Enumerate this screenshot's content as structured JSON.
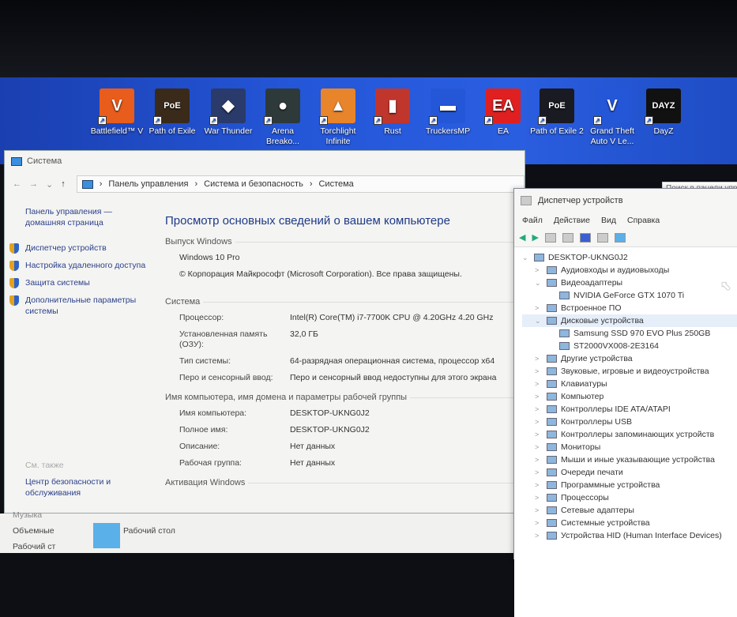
{
  "desktop_icons": [
    {
      "label": "Battlefield™ V",
      "color": "#e85c1c",
      "glyph": "V"
    },
    {
      "label": "Path of Exile",
      "color": "#3a2a1a",
      "glyph": "PoE"
    },
    {
      "label": "War Thunder",
      "color": "#2a3a6a",
      "glyph": "◆"
    },
    {
      "label": "Arena Breako...",
      "color": "#2e3a3a",
      "glyph": "●"
    },
    {
      "label": "Torchlight Infinite",
      "color": "#e8842a",
      "glyph": "▲"
    },
    {
      "label": "Rust",
      "color": "#c0362c",
      "glyph": "▮"
    },
    {
      "label": "TruckersMP",
      "color": "#2456d8",
      "glyph": "▬"
    },
    {
      "label": "EA",
      "color": "#e02020",
      "glyph": "EA"
    },
    {
      "label": "Path of Exile 2",
      "color": "#1a1a22",
      "glyph": "PoE"
    },
    {
      "label": "Grand Theft Auto V Le...",
      "color": "#2456d8",
      "glyph": "V"
    },
    {
      "label": "DayZ",
      "color": "#111",
      "glyph": "DAYZ"
    }
  ],
  "system_window": {
    "title": "Система",
    "breadcrumb": [
      "Панель управления",
      "Система и безопасность",
      "Система"
    ],
    "search_placeholder": "Поиск в панели управления",
    "left_links": {
      "home": "Панель управления — домашняя страница",
      "items": [
        "Диспетчер устройств",
        "Настройка удаленного доступа",
        "Защита системы",
        "Дополнительные параметры системы"
      ],
      "see_also": "См. также",
      "security": "Центр безопасности и обслуживания"
    },
    "heading": "Просмотр основных сведений о вашем компьютере",
    "edition_section": "Выпуск Windows",
    "edition": "Windows 10 Pro",
    "copyright": "© Корпорация Майкрософт (Microsoft Corporation). Все права защищены.",
    "system_section": "Система",
    "system_rows": [
      {
        "k": "Процессор:",
        "v": "Intel(R) Core(TM) i7-7700K CPU @ 4.20GHz   4.20 GHz"
      },
      {
        "k": "Установленная память (ОЗУ):",
        "v": "32,0 ГБ"
      },
      {
        "k": "Тип системы:",
        "v": "64-разрядная операционная система, процессор x64"
      },
      {
        "k": "Перо и сенсорный ввод:",
        "v": "Перо и сенсорный ввод недоступны для этого экрана"
      }
    ],
    "name_section": "Имя компьютера, имя домена и параметры рабочей группы",
    "name_rows": [
      {
        "k": "Имя компьютера:",
        "v": "DESKTOP-UKNG0J2"
      },
      {
        "k": "Полное имя:",
        "v": "DESKTOP-UKNG0J2"
      },
      {
        "k": "Описание:",
        "v": "Нет данных"
      },
      {
        "k": "Рабочая группа:",
        "v": "Нет данных"
      }
    ],
    "activation_section": "Активация Windows"
  },
  "device_manager": {
    "title": "Диспетчер устройств",
    "menu": [
      "Файл",
      "Действие",
      "Вид",
      "Справка"
    ],
    "tree": [
      {
        "label": "DESKTOP-UKNG0J2",
        "level": 0,
        "exp": "v"
      },
      {
        "label": "Аудиовходы и аудиовыходы",
        "level": 1,
        "exp": ">"
      },
      {
        "label": "Видеоадаптеры",
        "level": 1,
        "exp": "v"
      },
      {
        "label": "NVIDIA GeForce GTX 1070 Ti",
        "level": 2,
        "exp": ""
      },
      {
        "label": "Встроенное ПО",
        "level": 1,
        "exp": ">"
      },
      {
        "label": "Дисковые устройства",
        "level": 1,
        "exp": "v",
        "sel": true
      },
      {
        "label": "Samsung SSD 970 EVO Plus 250GB",
        "level": 2,
        "exp": ""
      },
      {
        "label": "ST2000VX008-2E3164",
        "level": 2,
        "exp": ""
      },
      {
        "label": "Другие устройства",
        "level": 1,
        "exp": ">"
      },
      {
        "label": "Звуковые, игровые и видеоустройства",
        "level": 1,
        "exp": ">"
      },
      {
        "label": "Клавиатуры",
        "level": 1,
        "exp": ">"
      },
      {
        "label": "Компьютер",
        "level": 1,
        "exp": ">"
      },
      {
        "label": "Контроллеры IDE ATA/ATAPI",
        "level": 1,
        "exp": ">"
      },
      {
        "label": "Контроллеры USB",
        "level": 1,
        "exp": ">"
      },
      {
        "label": "Контроллеры запоминающих устройств",
        "level": 1,
        "exp": ">"
      },
      {
        "label": "Мониторы",
        "level": 1,
        "exp": ">"
      },
      {
        "label": "Мыши и иные указывающие устройства",
        "level": 1,
        "exp": ">"
      },
      {
        "label": "Очереди печати",
        "level": 1,
        "exp": ">"
      },
      {
        "label": "Программные устройства",
        "level": 1,
        "exp": ">"
      },
      {
        "label": "Процессоры",
        "level": 1,
        "exp": ">"
      },
      {
        "label": "Сетевые адаптеры",
        "level": 1,
        "exp": ">"
      },
      {
        "label": "Системные устройства",
        "level": 1,
        "exp": ">"
      },
      {
        "label": "Устройства HID (Human Interface Devices)",
        "level": 1,
        "exp": ">"
      }
    ]
  },
  "explorer": {
    "nav": [
      "Музыка",
      "Объемные",
      "Рабочий ст"
    ],
    "folder": "Рабочий стол"
  }
}
